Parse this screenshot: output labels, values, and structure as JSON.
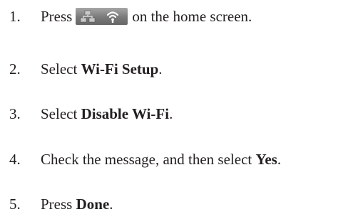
{
  "steps": [
    {
      "num": "1.",
      "before": "Press",
      "icon": "network-status-icon",
      "after": "on the home screen."
    },
    {
      "num": "2.",
      "before": "Select ",
      "bold": "Wi-Fi Setup",
      "after": "."
    },
    {
      "num": "3.",
      "before": "Select ",
      "bold": "Disable Wi-Fi",
      "after": "."
    },
    {
      "num": "4.",
      "before": "Check the message, and then select ",
      "bold": "Yes",
      "after": "."
    },
    {
      "num": "5.",
      "before": "Press ",
      "bold": "Done",
      "after": "."
    }
  ]
}
